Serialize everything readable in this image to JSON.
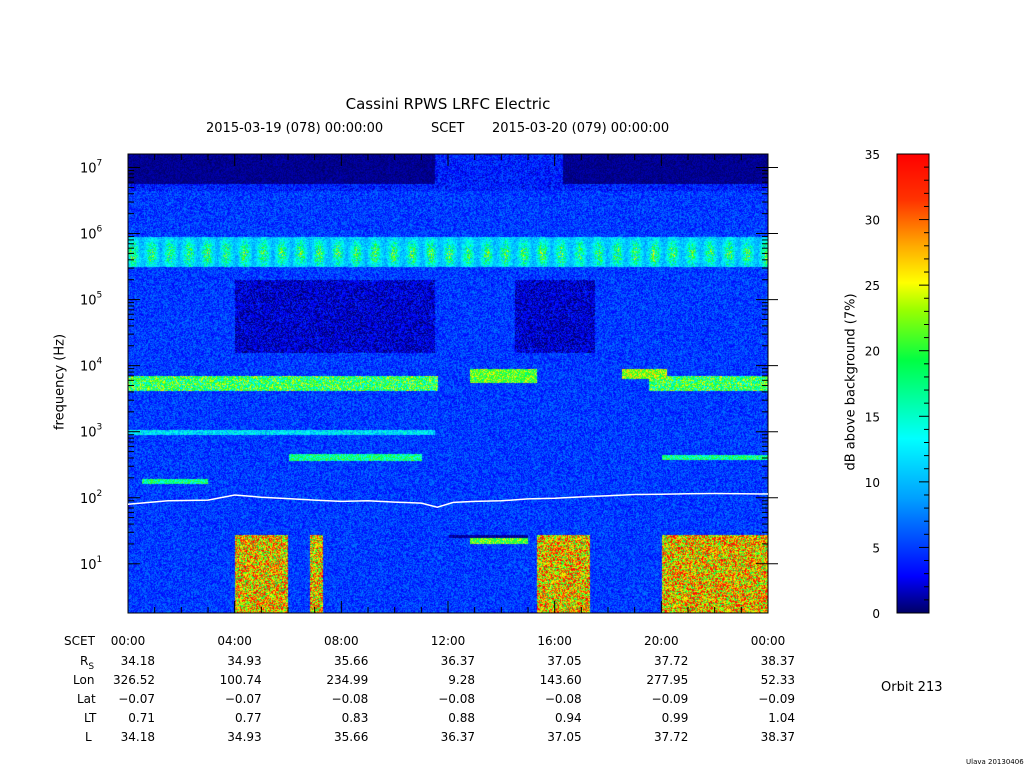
{
  "chart_data": {
    "type": "heatmap",
    "title": "Cassini RPWS LRFC Electric",
    "start_label": "2015-03-19 (078) 00:00:00",
    "time_system": "SCET",
    "end_label": "2015-03-20 (079) 00:00:00",
    "ylabel": "frequency (Hz)",
    "colorbar_label": "dB above background (7%)",
    "x_range_hours": [
      0,
      24
    ],
    "y_scale": "log",
    "ylim_hz": [
      1.8,
      16000000
    ],
    "y_ticks": [
      {
        "base": "10",
        "exp": "1",
        "value": 10
      },
      {
        "base": "10",
        "exp": "2",
        "value": 100
      },
      {
        "base": "10",
        "exp": "3",
        "value": 1000
      },
      {
        "base": "10",
        "exp": "4",
        "value": 10000
      },
      {
        "base": "10",
        "exp": "5",
        "value": 100000
      },
      {
        "base": "10",
        "exp": "6",
        "value": 1000000
      },
      {
        "base": "10",
        "exp": "7",
        "value": 10000000
      }
    ],
    "colorbar_range": [
      0,
      35
    ],
    "colorbar_ticks": [
      "0",
      "5",
      "10",
      "15",
      "20",
      "25",
      "30",
      "35"
    ],
    "colorscale": [
      "#000066",
      "#0000ff",
      "#00a0ff",
      "#00ffff",
      "#00ff66",
      "#33ff00",
      "#ccff00",
      "#ffff00",
      "#ff9900",
      "#ff3300",
      "#ff0000"
    ],
    "overlay_line": {
      "name": "electron cyclotron frequency",
      "color": "#ffffff",
      "points": [
        [
          0,
          80
        ],
        [
          1.5,
          90
        ],
        [
          3,
          92
        ],
        [
          4,
          110
        ],
        [
          5,
          102
        ],
        [
          6,
          97
        ],
        [
          7,
          92
        ],
        [
          8,
          88
        ],
        [
          9,
          90
        ],
        [
          10,
          86
        ],
        [
          11,
          83
        ],
        [
          11.6,
          72
        ],
        [
          12.2,
          85
        ],
        [
          13,
          88
        ],
        [
          14,
          90
        ],
        [
          15,
          96
        ],
        [
          16,
          98
        ],
        [
          17,
          103
        ],
        [
          18,
          107
        ],
        [
          19,
          112
        ],
        [
          20,
          113
        ],
        [
          21,
          115
        ],
        [
          22,
          116
        ],
        [
          23,
          115
        ],
        [
          24,
          114
        ]
      ]
    },
    "ephemeris": {
      "row_labels": [
        "SCET",
        "R",
        "Lon",
        "Lat",
        "LT",
        "L"
      ],
      "r_subscript": "S",
      "times": [
        "00:00",
        "04:00",
        "08:00",
        "12:00",
        "16:00",
        "20:00",
        "00:00"
      ],
      "rows": [
        [
          "34.18",
          "34.93",
          "35.66",
          "36.37",
          "37.05",
          "37.72",
          "38.37"
        ],
        [
          "326.52",
          "100.74",
          "234.99",
          "9.28",
          "143.60",
          "277.95",
          "52.33"
        ],
        [
          "−0.07",
          "−0.07",
          "−0.08",
          "−0.08",
          "−0.08",
          "−0.09",
          "−0.09"
        ],
        [
          "0.71",
          "0.77",
          "0.83",
          "0.88",
          "0.94",
          "0.99",
          "1.04"
        ],
        [
          "34.18",
          "34.93",
          "35.66",
          "36.37",
          "37.05",
          "37.72",
          "38.37"
        ]
      ]
    }
  },
  "orbit_label": "Orbit 213",
  "version_label": "Ulava 20130406"
}
